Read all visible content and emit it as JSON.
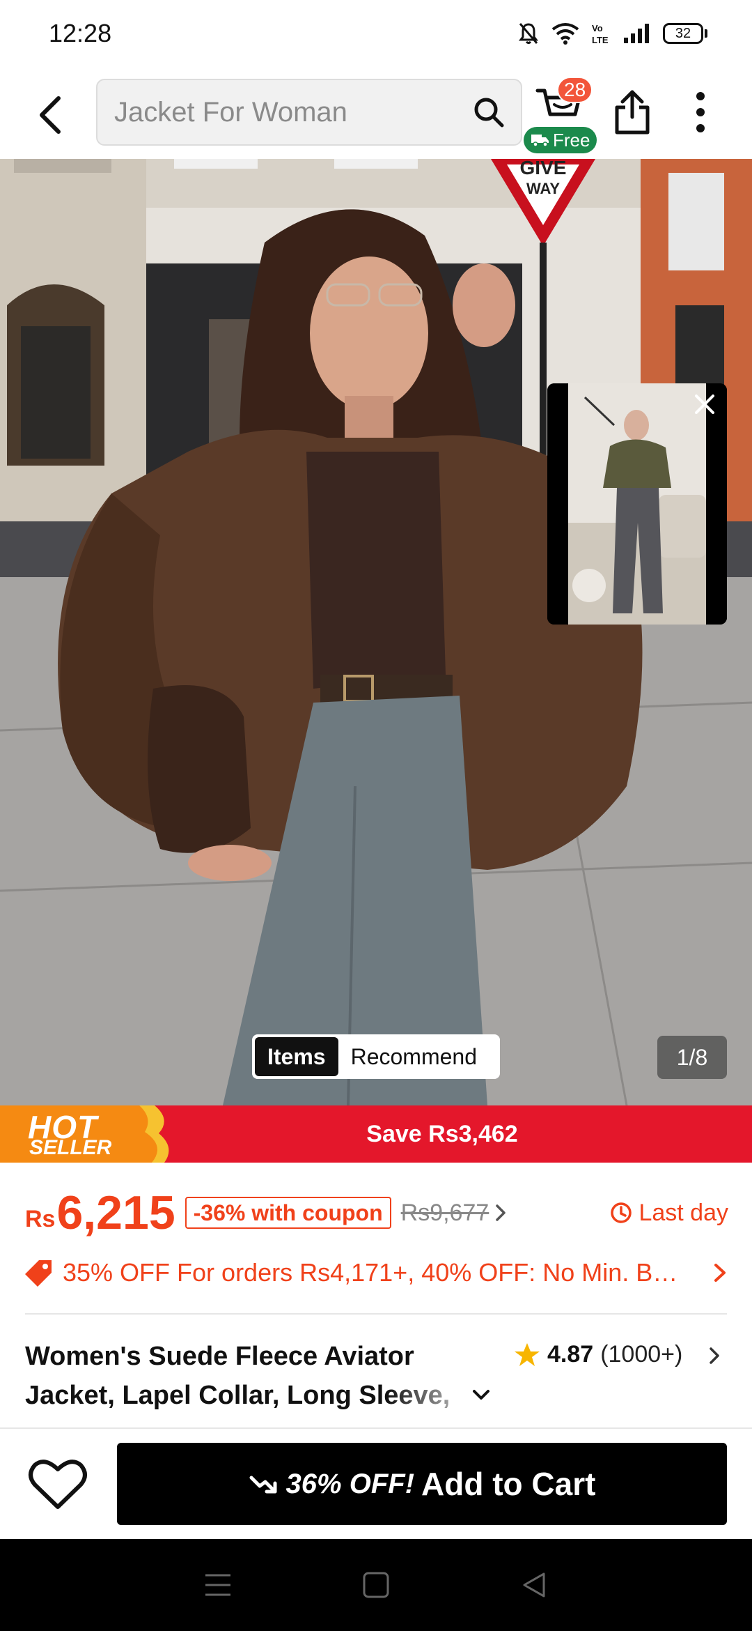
{
  "status_bar": {
    "time": "12:28",
    "battery": "32",
    "icons": [
      "mute-bell-icon",
      "wifi-icon",
      "volte-icon",
      "signal-icon",
      "battery-icon"
    ]
  },
  "header": {
    "search_text": "Jacket For Woman",
    "cart_count": "28",
    "free_label": "Free",
    "icons": [
      "back-icon",
      "search-icon",
      "cart-icon",
      "truck-icon",
      "share-icon",
      "more-icon"
    ]
  },
  "gallery": {
    "tab_items": "Items",
    "tab_recommend": "Recommend",
    "counter": "1/8",
    "sign_text_1": "GIVE",
    "sign_text_2": "WAY"
  },
  "banner": {
    "hot_line1": "HOT",
    "hot_line2": "SELLER",
    "save_text": "Save Rs3,462"
  },
  "price": {
    "currency": "Rs",
    "amount": "6,215",
    "discount": "-36%",
    "coupon_suffix": " with coupon",
    "original": "Rs9,677",
    "deadline": "Last day"
  },
  "promo": {
    "text": "35% OFF For orders Rs4,171+,  40% OFF: No Min. B…"
  },
  "product": {
    "title": "Women's Suede Fleece Aviator Jacket, Lapel Collar, Long Sleeve,",
    "rating": "4.87",
    "reviews": "(1000+)"
  },
  "actions": {
    "promo_label": "36% OFF!",
    "add_to_cart": "Add to Cart"
  },
  "colors": {
    "accent": "#f0411a",
    "banner_red": "#e4172b",
    "free_green": "#1b8a4c",
    "star": "#f7b500"
  }
}
